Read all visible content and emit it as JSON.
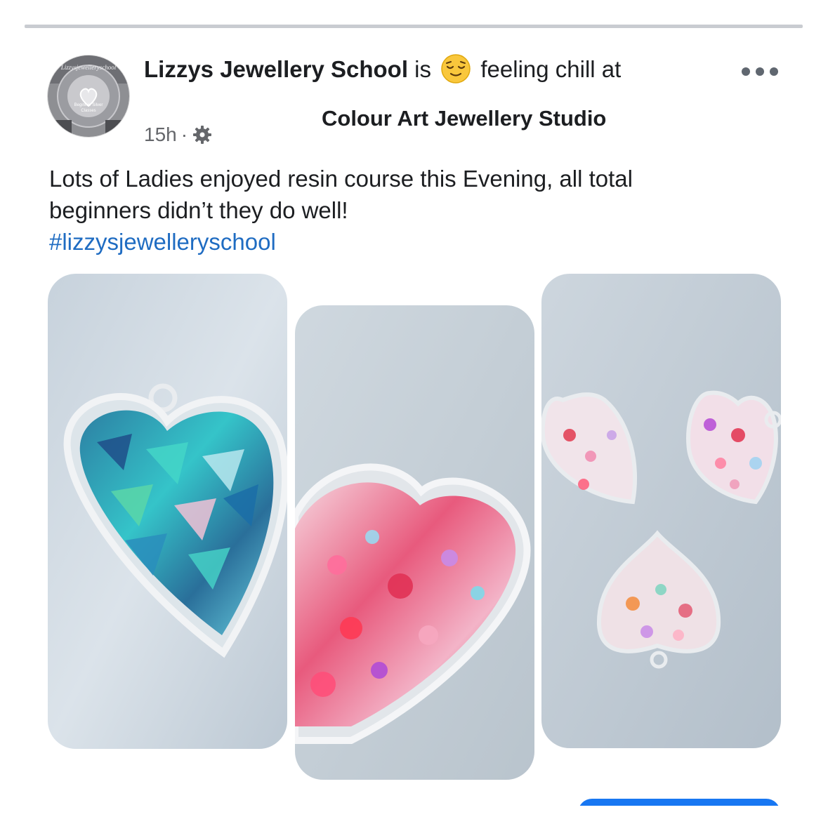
{
  "post": {
    "author": "Lizzys Jewellery School",
    "connector": "is",
    "feeling": "feeling chill at",
    "feeling_emoji": "relieved-face-icon",
    "location": "Colour Art Jewellery Studio",
    "timestamp": "15h",
    "separator": "·",
    "audience_icon": "gear-icon",
    "text_line1": "Lots of Ladies enjoyed resin course this Evening, all  total",
    "text_line2": "beginners didn’t they do well!",
    "hashtag": "#lizzysjewelleryschool"
  },
  "avatar": {
    "ring_text": "Lizzysjewelleryschool",
    "caption_line1": "Beginner Silver",
    "caption_line2": "Classes"
  },
  "photos": [
    {
      "subject": "blue-resin-heart-pendant"
    },
    {
      "subject": "pink-resin-heart-pendant"
    },
    {
      "subject": "three-pink-resin-hearts"
    }
  ],
  "colors": {
    "link": "#1f6cc2",
    "meta": "#65676b",
    "divider": "#c9ccd1",
    "button": "#1877f2"
  }
}
